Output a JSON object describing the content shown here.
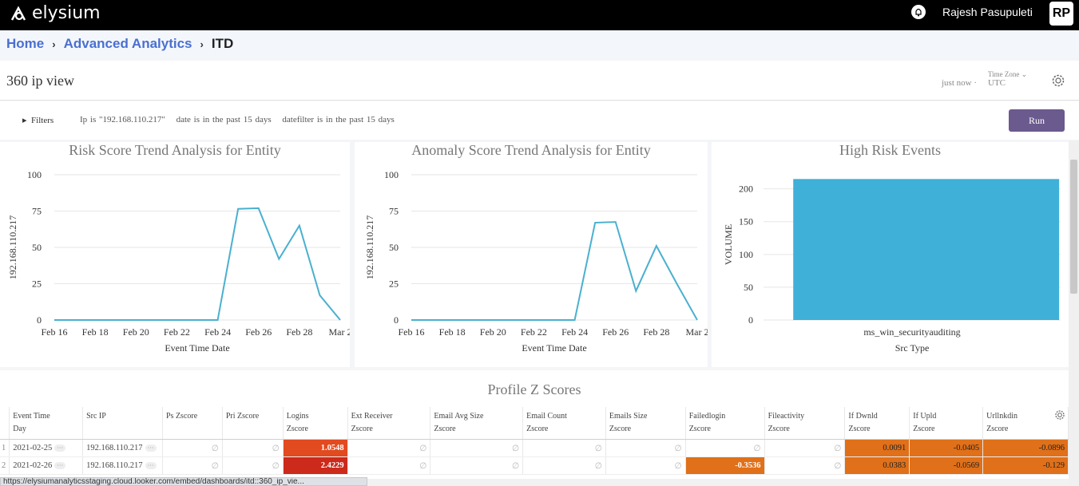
{
  "topbar": {
    "brand": "elysium",
    "user_name": "Rajesh Pasupuleti",
    "avatar": "RP"
  },
  "breadcrumb": {
    "home": "Home",
    "section": "Advanced Analytics",
    "current": "ITD"
  },
  "dashboard": {
    "title": "360 ip view",
    "refresh": "just now",
    "separator": "·",
    "timezone_label": "Time Zone",
    "timezone_value": "UTC"
  },
  "filters": {
    "toggle_label": "Filters",
    "items": [
      "Ip is \"192.168.110.217\"",
      "date is in the past 15 days",
      "datefilter is in the past 15 days"
    ],
    "run_label": "Run"
  },
  "charts": [
    {
      "type": "line",
      "title": "Risk Score Trend Analysis for Entity",
      "ylabel": "192.168.110.217",
      "xlabel": "Event Time Date",
      "ylim": [
        0,
        100
      ],
      "yticks": [
        "0",
        "25",
        "50",
        "75",
        "100"
      ],
      "xticks": [
        "Feb 16",
        "Feb 18",
        "Feb 20",
        "Feb 22",
        "Feb 24",
        "Feb 26",
        "Feb 28",
        "Mar 2"
      ],
      "x": [
        "2021-02-16",
        "2021-02-17",
        "2021-02-18",
        "2021-02-19",
        "2021-02-20",
        "2021-02-21",
        "2021-02-22",
        "2021-02-23",
        "2021-02-24",
        "2021-02-25",
        "2021-02-26",
        "2021-02-27",
        "2021-02-28",
        "2021-03-01",
        "2021-03-02"
      ],
      "values": [
        0,
        0,
        0,
        0,
        0,
        0,
        0,
        0,
        0,
        76.5,
        77,
        42,
        65,
        17,
        0
      ],
      "color": "#4ab0cf"
    },
    {
      "type": "line",
      "title": "Anomaly Score Trend Analysis for Entity",
      "ylabel": "192.168.110.217",
      "xlabel": "Event Time Date",
      "ylim": [
        0,
        100
      ],
      "yticks": [
        "0",
        "25",
        "50",
        "75",
        "100"
      ],
      "xticks": [
        "Feb 16",
        "Feb 18",
        "Feb 20",
        "Feb 22",
        "Feb 24",
        "Feb 26",
        "Feb 28",
        "Mar 2"
      ],
      "x": [
        "2021-02-16",
        "2021-02-17",
        "2021-02-18",
        "2021-02-19",
        "2021-02-20",
        "2021-02-21",
        "2021-02-22",
        "2021-02-23",
        "2021-02-24",
        "2021-02-25",
        "2021-02-26",
        "2021-02-27",
        "2021-02-28",
        "2021-03-01",
        "2021-03-02"
      ],
      "values": [
        0,
        0,
        0,
        0,
        0,
        0,
        0,
        0,
        0,
        67,
        67.5,
        20,
        51,
        25,
        0
      ],
      "color": "#4ab0cf"
    },
    {
      "type": "bar",
      "title": "High Risk Events",
      "ylabel": "VOLUME",
      "xlabel": "Src Type",
      "ylim": [
        0,
        230
      ],
      "yticks": [
        "0",
        "50",
        "100",
        "150",
        "200"
      ],
      "categories": [
        "ms_win_securityauditing"
      ],
      "values": [
        215
      ],
      "color": "#3fb0d8"
    }
  ],
  "profile_table": {
    "title": "Profile Z Scores",
    "columns": [
      [
        "Event Time",
        "Day"
      ],
      [
        "Src IP",
        ""
      ],
      [
        "Ps Zscore",
        ""
      ],
      [
        "Pri Zscore",
        ""
      ],
      [
        "Logins",
        "Zscore"
      ],
      [
        "Ext Receiver",
        "Zscore"
      ],
      [
        "Email Avg Size",
        "Zscore"
      ],
      [
        "Email Count",
        "Zscore"
      ],
      [
        "Emails Size",
        "Zscore"
      ],
      [
        "Failedlogin",
        "Zscore"
      ],
      [
        "Fileactivity",
        "Zscore"
      ],
      [
        "If Dwnld",
        "Zscore"
      ],
      [
        "If Upld",
        "Zscore"
      ],
      [
        "Urllnkdin",
        "Zscore"
      ]
    ],
    "null_symbol": "∅",
    "more": "···",
    "rows": [
      {
        "index": "1",
        "cells": [
          "2021-02-25",
          "192.168.110.217",
          "∅",
          "∅",
          "1.0548",
          "∅",
          "∅",
          "∅",
          "∅",
          "∅",
          "∅",
          "0.0091",
          "-0.0405",
          "-0.0896"
        ]
      },
      {
        "index": "2",
        "cells": [
          "2021-02-26",
          "192.168.110.217",
          "∅",
          "∅",
          "2.4229",
          "∅",
          "∅",
          "∅",
          "∅",
          "-0.3536",
          "∅",
          "0.0383",
          "-0.0569",
          "-0.129"
        ]
      }
    ]
  },
  "status_url": "https://elysiumanalyticsstaging.cloud.looker.com/embed/dashboards/itd::360_ip_vie..."
}
